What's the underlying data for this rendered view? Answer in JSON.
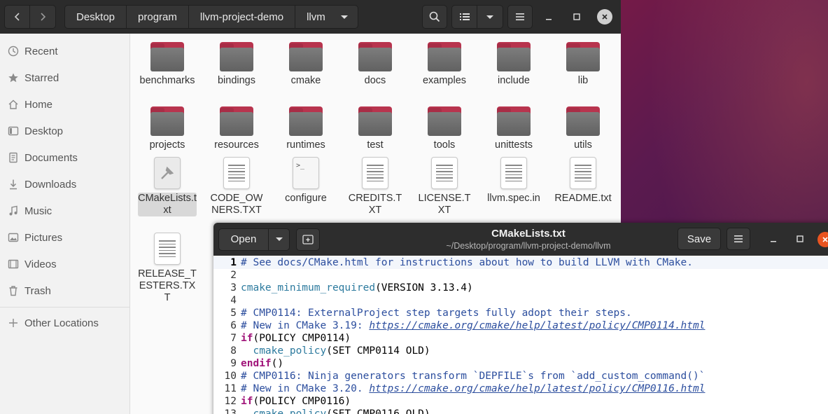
{
  "files": {
    "path": [
      "Desktop",
      "program",
      "llvm-project-demo",
      "llvm"
    ],
    "sidebar": [
      {
        "label": "Recent",
        "icon": "clock-icon"
      },
      {
        "label": "Starred",
        "icon": "star-icon"
      },
      {
        "label": "Home",
        "icon": "home-icon"
      },
      {
        "label": "Desktop",
        "icon": "desktop-icon"
      },
      {
        "label": "Documents",
        "icon": "document-icon"
      },
      {
        "label": "Downloads",
        "icon": "download-icon"
      },
      {
        "label": "Music",
        "icon": "music-icon"
      },
      {
        "label": "Pictures",
        "icon": "picture-icon"
      },
      {
        "label": "Videos",
        "icon": "video-icon"
      },
      {
        "label": "Trash",
        "icon": "trash-icon"
      },
      {
        "label": "Other Locations",
        "icon": "plus-icon"
      }
    ],
    "items": [
      {
        "label": "benchmarks",
        "type": "folder"
      },
      {
        "label": "bindings",
        "type": "folder"
      },
      {
        "label": "cmake",
        "type": "folder"
      },
      {
        "label": "docs",
        "type": "folder"
      },
      {
        "label": "examples",
        "type": "folder"
      },
      {
        "label": "include",
        "type": "folder"
      },
      {
        "label": "lib",
        "type": "folder"
      },
      {
        "label": "projects",
        "type": "folder"
      },
      {
        "label": "resources",
        "type": "folder"
      },
      {
        "label": "runtimes",
        "type": "folder"
      },
      {
        "label": "test",
        "type": "folder"
      },
      {
        "label": "tools",
        "type": "folder"
      },
      {
        "label": "unittests",
        "type": "folder"
      },
      {
        "label": "utils",
        "type": "folder"
      },
      {
        "label": "CMakeLists.txt",
        "type": "cmake",
        "selected": true
      },
      {
        "label": "CODE_OWNERS.TXT",
        "type": "text"
      },
      {
        "label": "configure",
        "type": "script"
      },
      {
        "label": "CREDITS.TXT",
        "type": "text"
      },
      {
        "label": "LICENSE.TXT",
        "type": "text"
      },
      {
        "label": "llvm.spec.in",
        "type": "text"
      },
      {
        "label": "README.txt",
        "type": "text"
      },
      {
        "label": "RELEASE_TESTERS.TXT",
        "type": "text"
      }
    ]
  },
  "editor": {
    "open_label": "Open",
    "save_label": "Save",
    "title": "CMakeLists.txt",
    "subtitle": "~/Desktop/program/llvm-project-demo/llvm",
    "current_line": 1,
    "lines": [
      {
        "n": "1",
        "parts": [
          {
            "t": "# See docs/CMake.html for instructions about how to build LLVM with CMake.",
            "c": "cm"
          }
        ]
      },
      {
        "n": "2",
        "parts": []
      },
      {
        "n": "3",
        "parts": [
          {
            "t": "cmake_minimum_required",
            "c": "fn"
          },
          {
            "t": "(VERSION 3.13.4)",
            "c": "tx"
          }
        ]
      },
      {
        "n": "4",
        "parts": []
      },
      {
        "n": "5",
        "parts": [
          {
            "t": "# CMP0114: ExternalProject step targets fully adopt their steps.",
            "c": "cm"
          }
        ]
      },
      {
        "n": "6",
        "parts": [
          {
            "t": "# New in CMake 3.19: ",
            "c": "cm"
          },
          {
            "t": "https://cmake.org/cmake/help/latest/policy/CMP0114.html",
            "c": "url"
          }
        ]
      },
      {
        "n": "7",
        "parts": [
          {
            "t": "if",
            "c": "kw"
          },
          {
            "t": "(POLICY CMP0114)",
            "c": "tx"
          }
        ]
      },
      {
        "n": "8",
        "parts": [
          {
            "t": "  ",
            "c": "tx"
          },
          {
            "t": "cmake_policy",
            "c": "fn"
          },
          {
            "t": "(SET CMP0114 OLD)",
            "c": "tx"
          }
        ]
      },
      {
        "n": "9",
        "parts": [
          {
            "t": "endif",
            "c": "kw"
          },
          {
            "t": "()",
            "c": "tx"
          }
        ]
      },
      {
        "n": "10",
        "parts": [
          {
            "t": "# CMP0116: Ninja generators transform `DEPFILE`s from `add_custom_command()`",
            "c": "cm"
          }
        ]
      },
      {
        "n": "11",
        "parts": [
          {
            "t": "# New in CMake 3.20. ",
            "c": "cm"
          },
          {
            "t": "https://cmake.org/cmake/help/latest/policy/CMP0116.html",
            "c": "url"
          }
        ]
      },
      {
        "n": "12",
        "parts": [
          {
            "t": "if",
            "c": "kw"
          },
          {
            "t": "(POLICY CMP0116)",
            "c": "tx"
          }
        ]
      },
      {
        "n": "13",
        "parts": [
          {
            "t": "  ",
            "c": "tx"
          },
          {
            "t": "cmake_policy",
            "c": "fn"
          },
          {
            "t": "(SET CMP0116 OLD)",
            "c": "tx"
          }
        ]
      }
    ]
  },
  "colors": {
    "accent": "#e95420",
    "folder_tab": "#b8344e",
    "comment": "#2c4e9e",
    "keyword": "#a1157a"
  }
}
